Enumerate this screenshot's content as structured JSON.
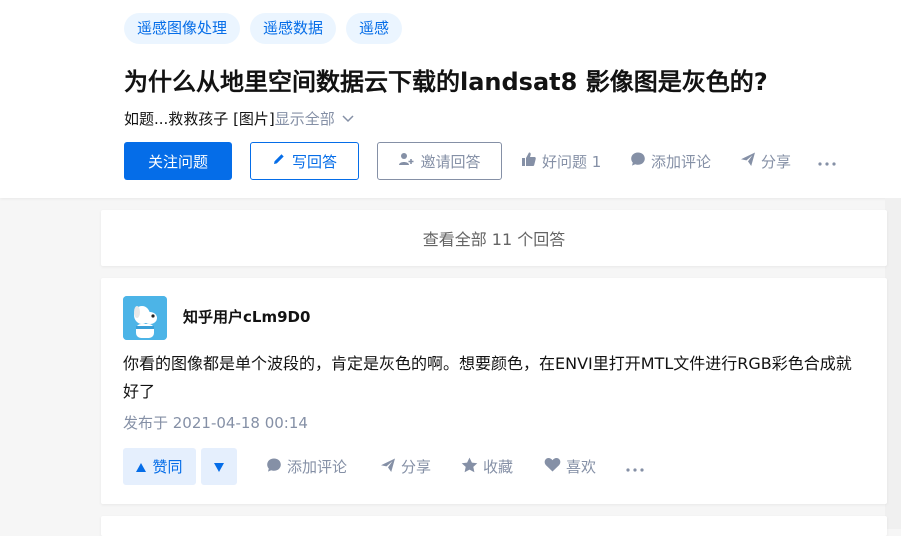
{
  "topics": [
    "遥感图像处理",
    "遥感数据",
    "遥感"
  ],
  "question": {
    "title": "为什么从地里空间数据云下载的landsat8 影像图是灰色的?",
    "detail": "如题...救救孩子 [图片]",
    "show_all": "显示全部"
  },
  "actions": {
    "follow": "关注问题",
    "write": "写回答",
    "invite": "邀请回答",
    "good_question": "好问题 1",
    "comment": "添加评论",
    "share": "分享"
  },
  "view_all": "查看全部 11 个回答",
  "answer": {
    "author": "知乎用户cLm9D0",
    "content": "你看的图像都是单个波段的，肯定是灰色的啊。想要颜色，在ENVI里打开MTL文件进行RGB彩色合成就好了",
    "published": "发布于 2021-04-18 00:14",
    "upvote": "赞同",
    "comment": "添加评论",
    "share": "分享",
    "collect": "收藏",
    "like": "喜欢"
  },
  "colors": {
    "brand": "#056de8",
    "muted": "#8590a6",
    "tag_bg": "#ebf5ff",
    "vote_bg": "#e5effd"
  }
}
